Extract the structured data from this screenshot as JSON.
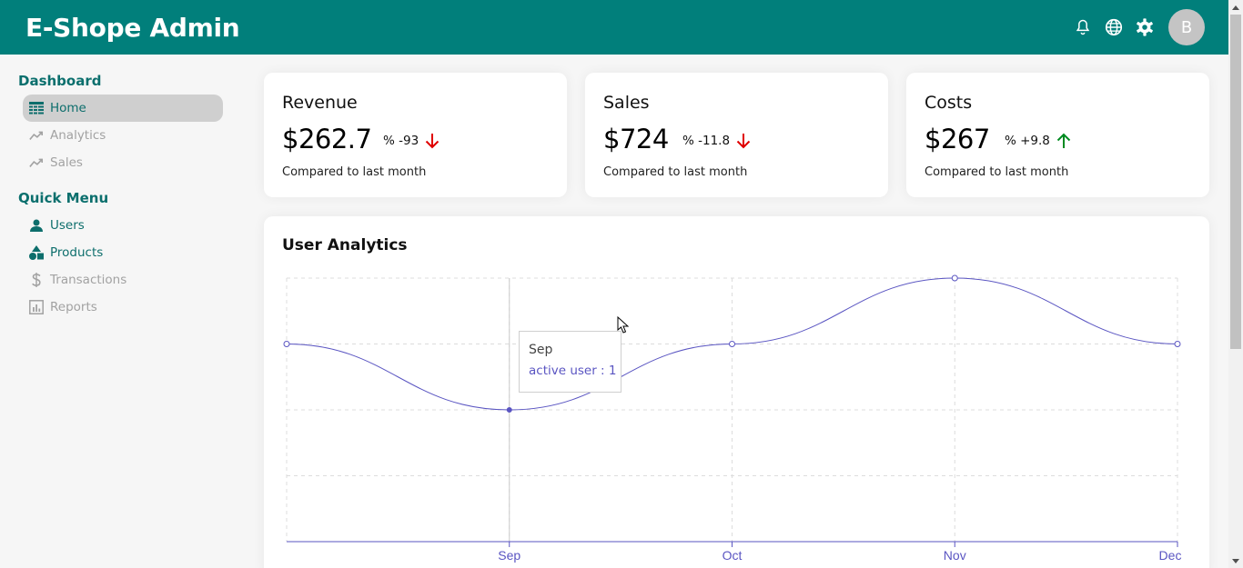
{
  "app": {
    "title": "E-Shope Admin",
    "avatar_letter": "B"
  },
  "topbar": {
    "icons": [
      "bell-icon",
      "globe-icon",
      "gear-icon"
    ]
  },
  "sidebar": {
    "sections": [
      {
        "title": "Dashboard",
        "items": [
          {
            "label": "Home",
            "icon": "table-icon",
            "active": true
          },
          {
            "label": "Analytics",
            "icon": "trend-icon"
          },
          {
            "label": "Sales",
            "icon": "trend-icon"
          }
        ]
      },
      {
        "title": "Quick Menu",
        "items": [
          {
            "label": "Users",
            "icon": "person-icon"
          },
          {
            "label": "Products",
            "icon": "shapes-icon"
          },
          {
            "label": "Transactions",
            "icon": "dollar-icon"
          },
          {
            "label": "Reports",
            "icon": "bar-chart-icon"
          }
        ]
      }
    ]
  },
  "cards": [
    {
      "title": "Revenue",
      "value": "$262.7",
      "rate": "% -93",
      "trend": "down",
      "sub": "Compared to last month"
    },
    {
      "title": "Sales",
      "value": "$724",
      "rate": "% -11.8",
      "trend": "down",
      "sub": "Compared to last month"
    },
    {
      "title": "Costs",
      "value": "$267",
      "rate": "% +9.8",
      "trend": "up",
      "sub": "Compared to last month"
    }
  ],
  "colors": {
    "brand": "#017f7b",
    "line": "#5a55c2",
    "down": "#e00000",
    "up": "#008a20"
  },
  "analytics": {
    "title": "User Analytics",
    "tooltip": {
      "label": "Sep",
      "value": "active user : 1"
    }
  },
  "chart_data": {
    "type": "line",
    "title": "User Analytics",
    "categories": [
      "Sep",
      "Oct",
      "Nov",
      "Dec"
    ],
    "series": [
      {
        "name": "active user",
        "values": [
          1,
          2,
          3,
          2
        ]
      }
    ],
    "first_point_value": 2,
    "ylim": [
      -1,
      3
    ],
    "grid": true,
    "xlabel": "",
    "ylabel": ""
  }
}
